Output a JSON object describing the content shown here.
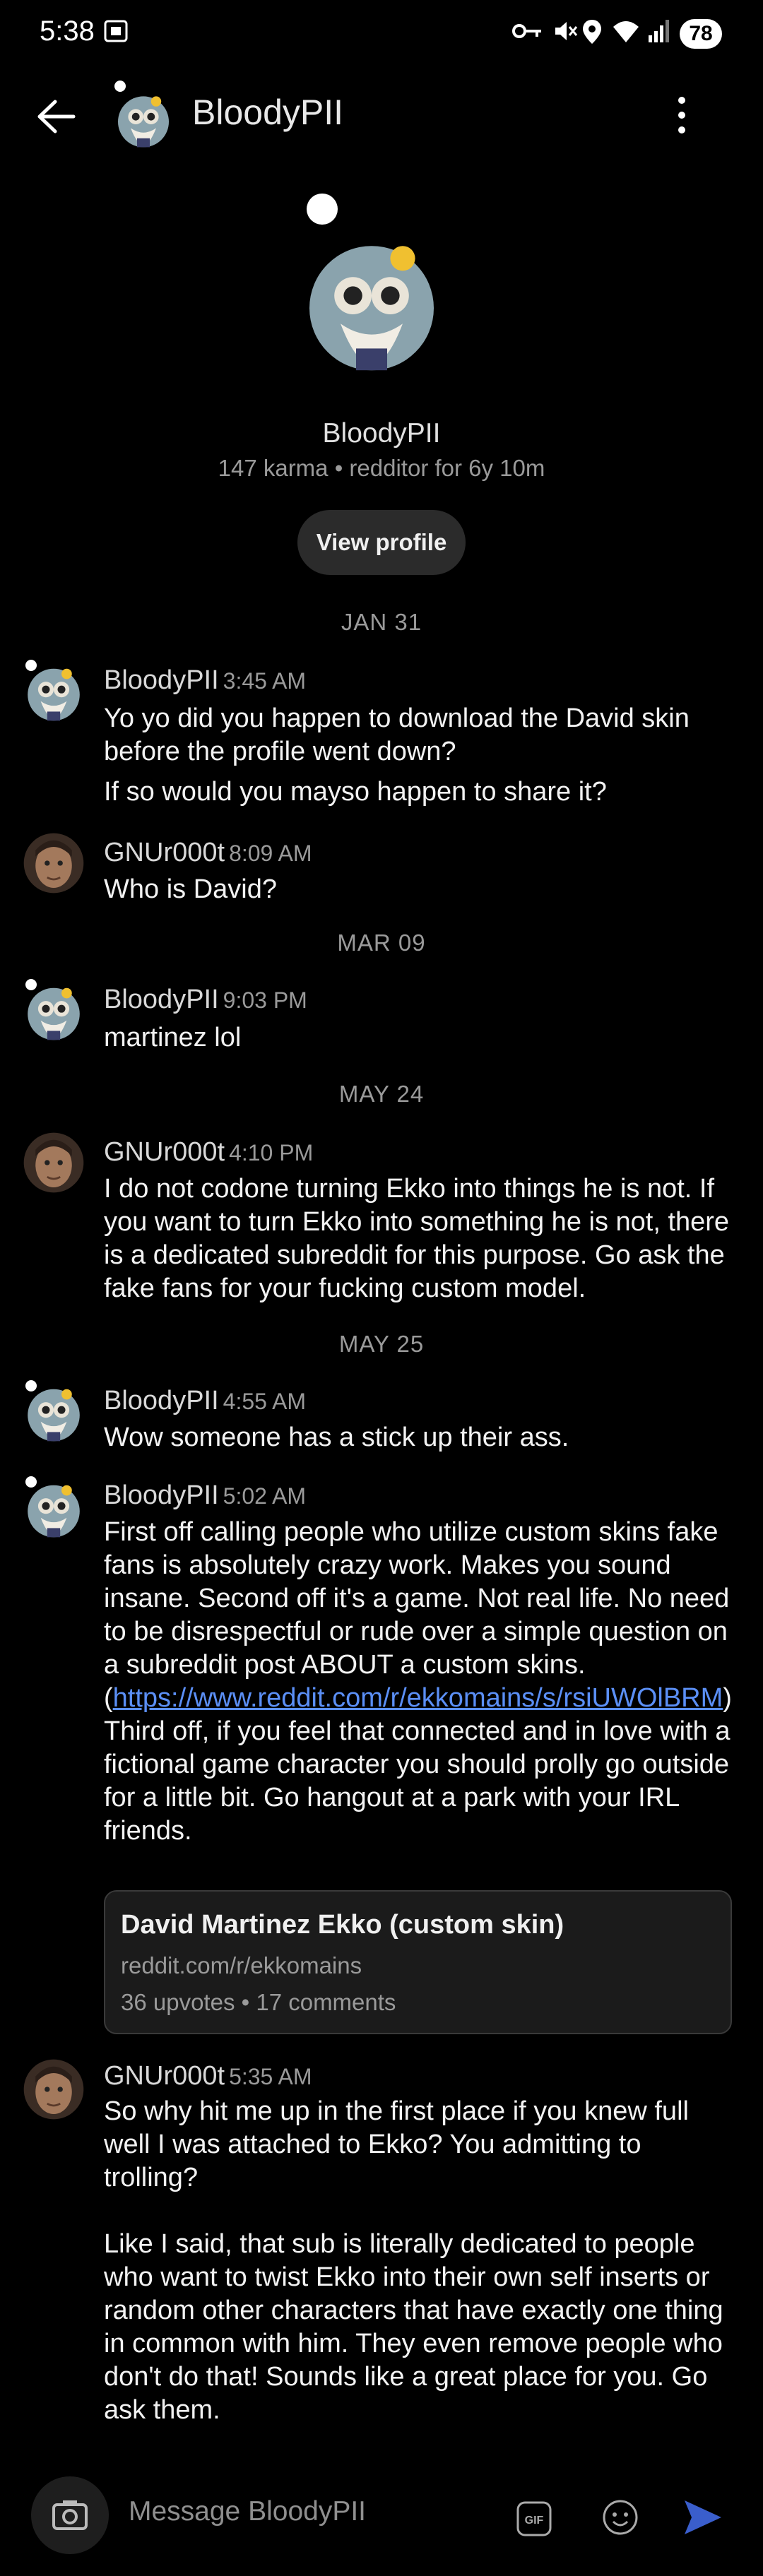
{
  "status_bar": {
    "time": "5:38",
    "battery": "78",
    "icons": [
      "screenshot-icon",
      "vpn-key-icon",
      "mute-icon",
      "location-icon",
      "wifi-icon",
      "signal-icon",
      "battery-icon"
    ]
  },
  "header": {
    "title": "BloodyPII",
    "icons": [
      "back-arrow-icon",
      "avatar",
      "more-vert-icon"
    ]
  },
  "profile": {
    "name": "BloodyPII",
    "meta": "147 karma • redditor for 6y 10m",
    "view_button": "View profile"
  },
  "dates": [
    "JAN 31",
    "MAR 09",
    "MAY 24",
    "MAY 25"
  ],
  "messages": [
    {
      "sender": "BloodyPII",
      "time": "3:45 AM",
      "lines": [
        "Yo yo did you happen to download the David skin before the profile went down?",
        "If so would you mayso happen to share it?"
      ]
    },
    {
      "sender": "GNUr000t",
      "time": "8:09 AM",
      "text": "Who is David?"
    },
    {
      "sender": "BloodyPII",
      "time": "9:03 PM",
      "text": "martinez lol"
    },
    {
      "sender": "GNUr000t",
      "time": "4:10 PM",
      "text": "I do not codone turning Ekko into things he is not. If you want to turn Ekko into something he is not, there is a dedicated subreddit for this purpose. Go ask the fake fans for your fucking custom model."
    },
    {
      "sender": "BloodyPII",
      "time": "4:55 AM",
      "text": "Wow someone has a stick up their ass."
    },
    {
      "sender": "BloodyPII",
      "time": "5:02 AM",
      "text_before": "First off calling people who utilize custom skins fake fans is absolutely crazy work. Makes you sound insane. Second off it's a game. Not real life. No need to be disrespectful or rude over a simple question on a subreddit post ABOUT a custom skins. (",
      "link": "https://www.reddit.com/r/ekkomains/s/rsiUWOlBRM",
      "text_after": ") Third off, if you feel that connected and in love with a fictional game character you should prolly go outside for a little bit. Go hangout at a park with your IRL friends."
    },
    {
      "sender": "GNUr000t",
      "time": "5:35 AM",
      "paragraphs": [
        "So why hit me up in the first place if you knew full well I was attached to Ekko? You admitting to trolling?",
        "Like I said, that sub is literally dedicated to people who want to twist Ekko into their own self inserts or random other characters that have exactly one thing in common with him. They even remove people who don't do that! Sounds like a great place for you. Go ask them."
      ]
    }
  ],
  "link_card": {
    "title": "David Martinez Ekko (custom skin)",
    "subreddit": "reddit.com/r/ekkomains",
    "stats": "36 upvotes • 17 comments"
  },
  "composer": {
    "placeholder": "Message BloodyPII",
    "gif_label": "GIF"
  },
  "colors": {
    "background": "#000000",
    "link": "#5b8ff6",
    "send": "#3a5ecc"
  }
}
